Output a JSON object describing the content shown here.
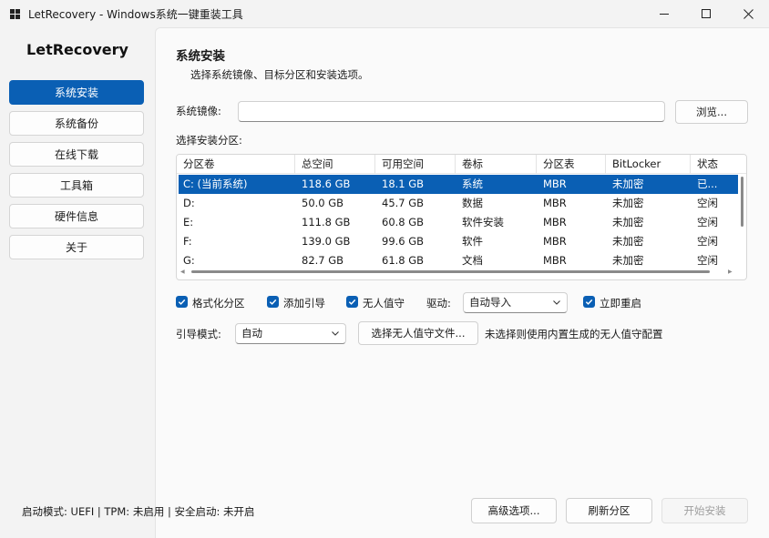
{
  "window": {
    "title": "LetRecovery - Windows系统一键重装工具"
  },
  "sidebar": {
    "app_name": "LetRecovery",
    "items": [
      {
        "label": "系统安装",
        "active": true
      },
      {
        "label": "系统备份",
        "active": false
      },
      {
        "label": "在线下载",
        "active": false
      },
      {
        "label": "工具箱",
        "active": false
      },
      {
        "label": "硬件信息",
        "active": false
      },
      {
        "label": "关于",
        "active": false
      }
    ]
  },
  "main": {
    "title": "系统安装",
    "subtitle": "选择系统镜像、目标分区和安装选项。",
    "image_label": "系统镜像:",
    "image_value": "",
    "browse_button": "浏览...",
    "partition_label": "选择安装分区:",
    "table": {
      "columns": [
        "分区卷",
        "总空间",
        "可用空间",
        "卷标",
        "分区表",
        "BitLocker",
        "状态"
      ],
      "rows": [
        [
          "C: (当前系统)",
          "118.6 GB",
          "18.1 GB",
          "系统",
          "MBR",
          "未加密",
          "已..."
        ],
        [
          "D:",
          "50.0 GB",
          "45.7 GB",
          "数据",
          "MBR",
          "未加密",
          "空闲"
        ],
        [
          "E:",
          "111.8 GB",
          "60.8 GB",
          "软件安装",
          "MBR",
          "未加密",
          "空闲"
        ],
        [
          "F:",
          "139.0 GB",
          "99.6 GB",
          "软件",
          "MBR",
          "未加密",
          "空闲"
        ],
        [
          "G:",
          "82.7 GB",
          "61.8 GB",
          "文档",
          "MBR",
          "未加密",
          "空闲"
        ]
      ],
      "selected_row": 0
    },
    "options": {
      "format": {
        "label": "格式化分区",
        "checked": true
      },
      "add_boot": {
        "label": "添加引导",
        "checked": true
      },
      "unattended": {
        "label": "无人值守",
        "checked": true
      },
      "driver_label": "驱动:",
      "driver_value": "自动导入",
      "reboot": {
        "label": "立即重启",
        "checked": true
      }
    },
    "boot_mode_label": "引导模式:",
    "boot_mode_value": "自动",
    "unattend_file_button": "选择无人值守文件...",
    "unattend_hint": "未选择则使用内置生成的无人值守配置"
  },
  "footer": {
    "status": "启动模式: UEFI | TPM: 未启用 | 安全启动: 未开启",
    "advanced_button": "高级选项...",
    "refresh_button": "刷新分区",
    "start_button": "开始安装"
  },
  "colors": {
    "accent": "#0a5fb4",
    "background": "#f3f3f3"
  }
}
